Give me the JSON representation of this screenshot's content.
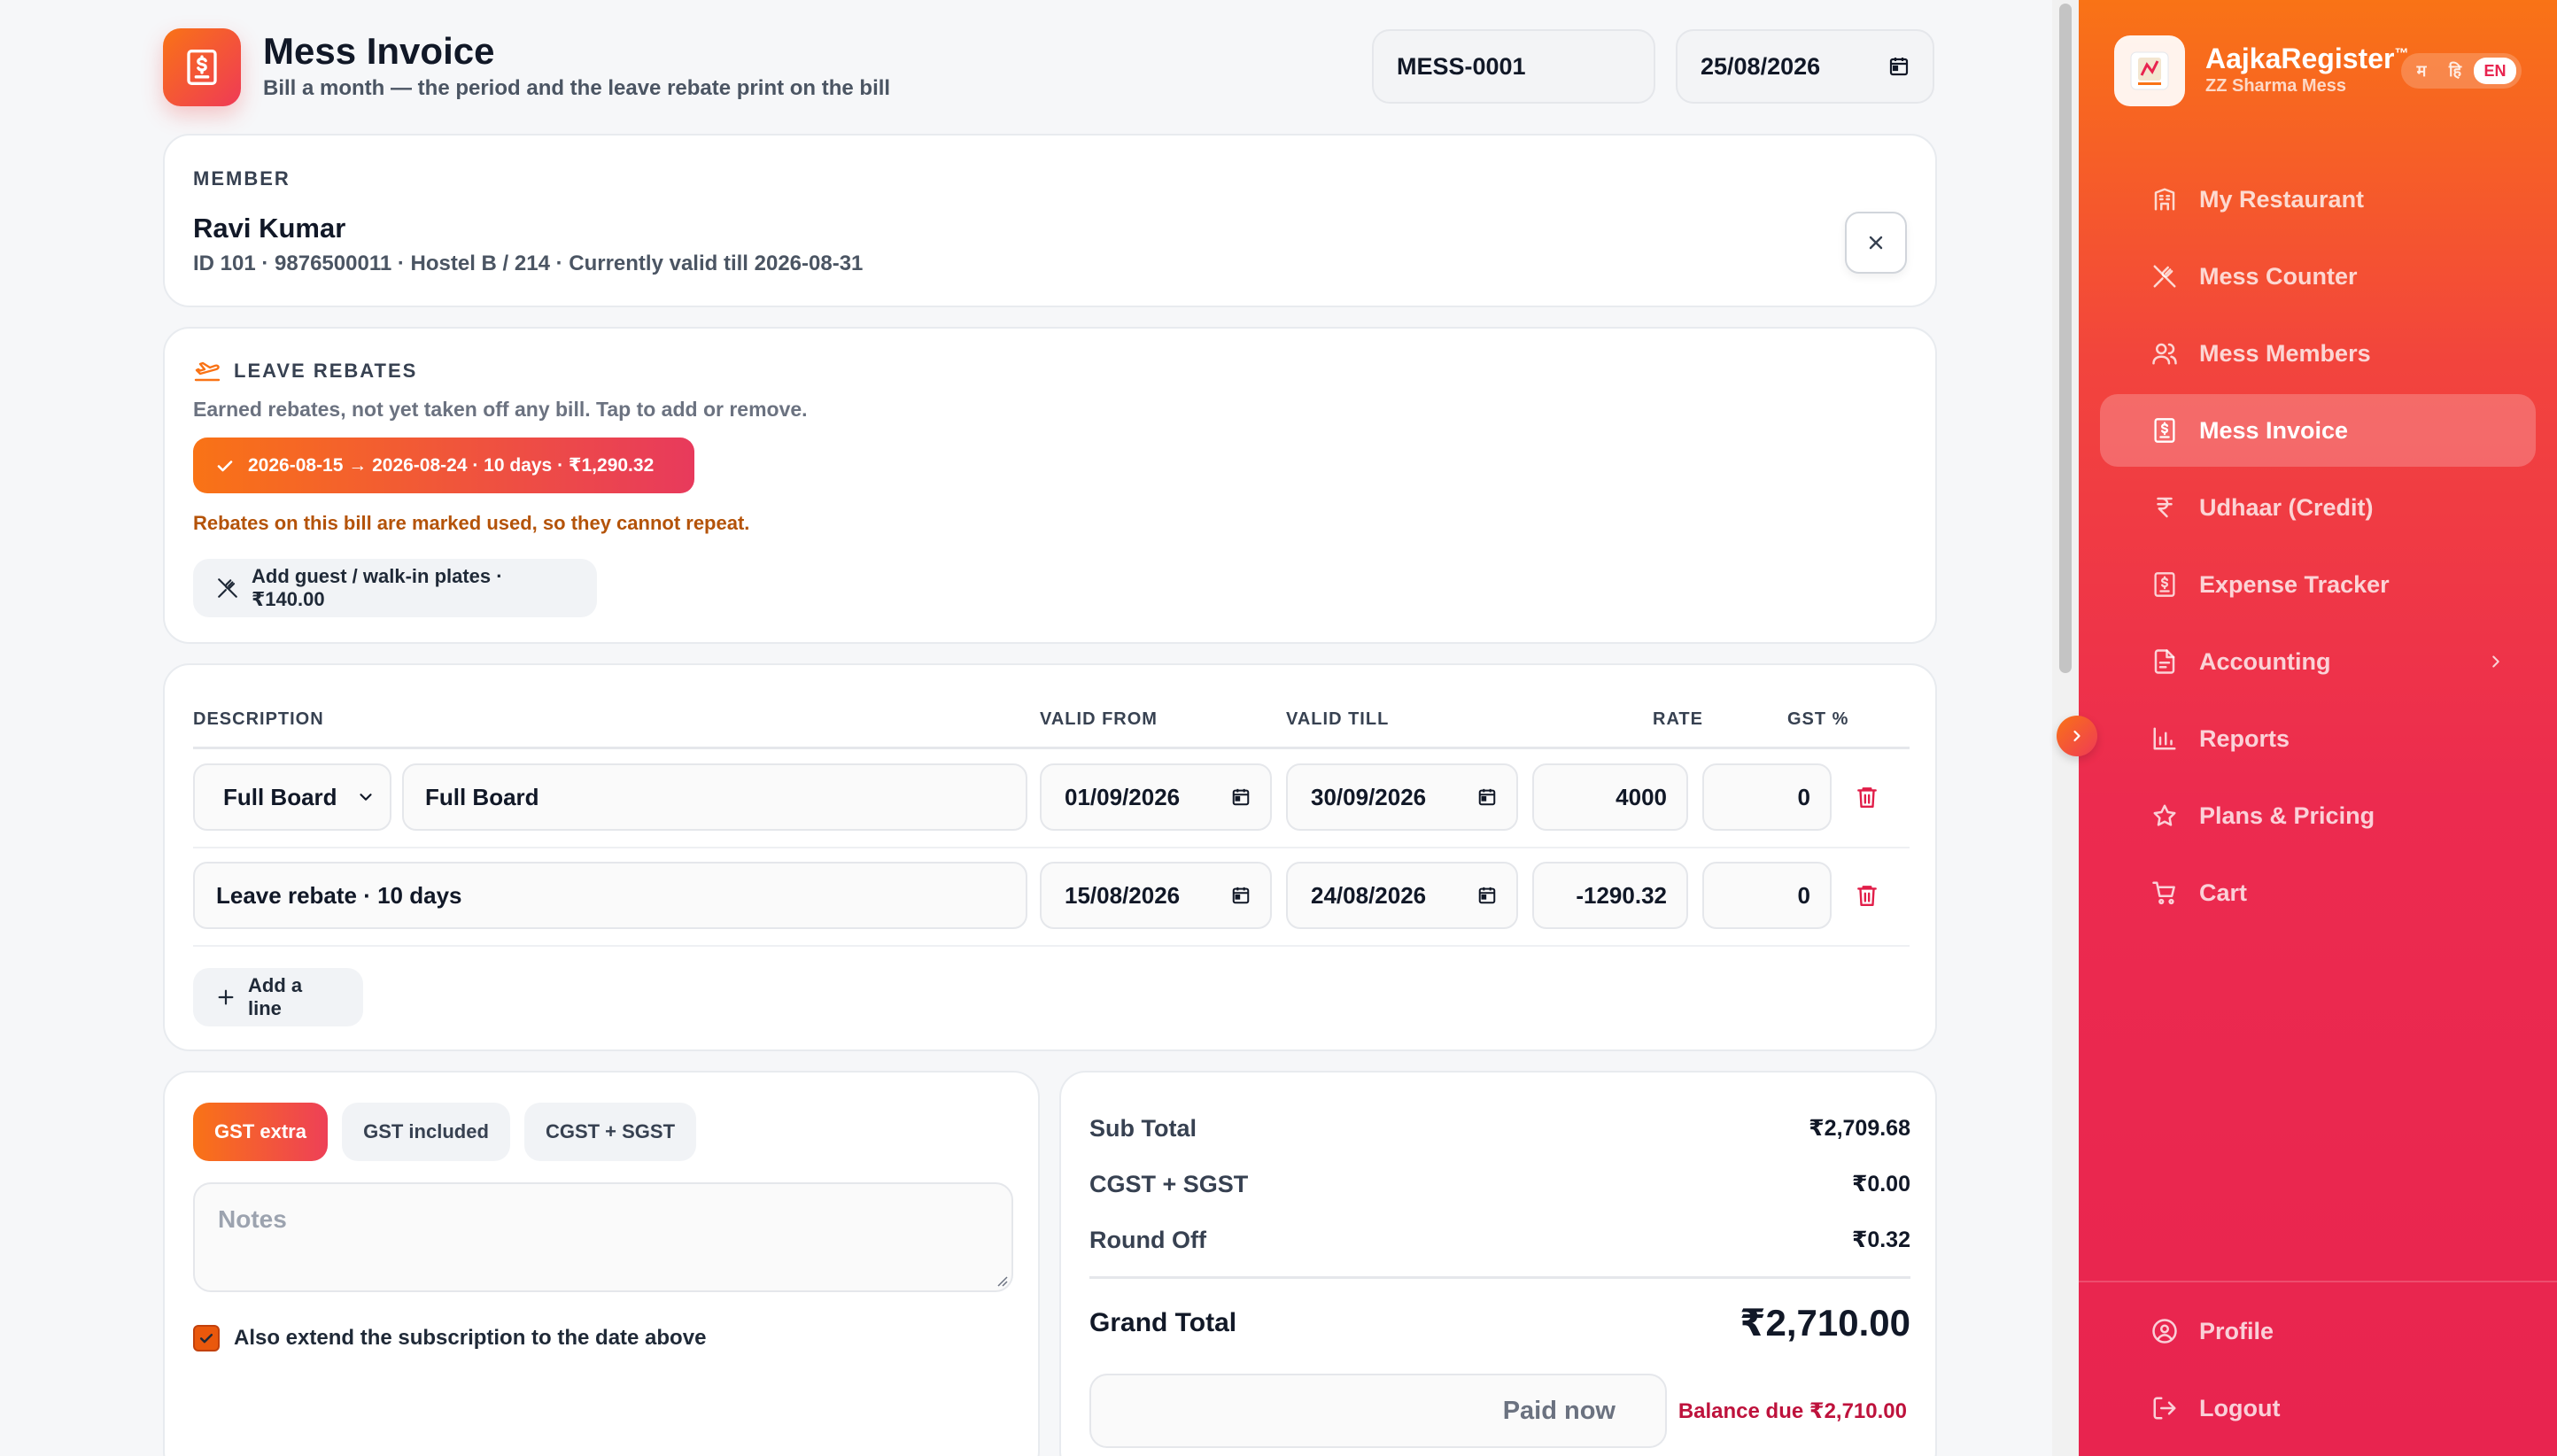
{
  "header": {
    "title": "Mess Invoice",
    "subtitle": "Bill a month — the period and the leave rebate print on the bill",
    "invoice_number": "MESS-0001",
    "invoice_date": "25/08/2026"
  },
  "member": {
    "section_label": "MEMBER",
    "name": "Ravi Kumar",
    "meta": "ID 101 · 9876500011 · Hostel B / 214 · Currently valid till 2026-08-31"
  },
  "rebates": {
    "section_label": "LEAVE REBATES",
    "description": "Earned rebates, not yet taken off any bill. Tap to add or remove.",
    "chip_label": "2026-08-15 → 2026-08-24 · 10 days · ₹1,290.32",
    "warning": "Rebates on this bill are marked used, so they cannot repeat.",
    "guest_label": "Add guest / walk-in plates · ₹140.00"
  },
  "lines": {
    "headers": {
      "description": "DESCRIPTION",
      "valid_from": "VALID FROM",
      "valid_till": "VALID TILL",
      "rate": "RATE",
      "gst": "GST %"
    },
    "rows": [
      {
        "plan": "Full Board",
        "description": "Full Board",
        "valid_from": "01/09/2026",
        "valid_till": "30/09/2026",
        "rate": "4000",
        "gst": "0"
      },
      {
        "description": "Leave rebate · 10 days",
        "valid_from": "15/08/2026",
        "valid_till": "24/08/2026",
        "rate": "-1290.32",
        "gst": "0"
      }
    ],
    "add_line_label": "Add a line"
  },
  "options": {
    "gst_tabs": [
      "GST extra",
      "GST included",
      "CGST + SGST"
    ],
    "notes_placeholder": "Notes",
    "extend_label": "Also extend the subscription to the date above",
    "extend_checked": true
  },
  "totals": {
    "sub_total_label": "Sub Total",
    "sub_total": "₹2,709.68",
    "gst_label": "CGST + SGST",
    "gst_value": "₹0.00",
    "round_off_label": "Round Off",
    "round_off": "₹0.32",
    "grand_total_label": "Grand Total",
    "grand_total": "₹2,710.00",
    "paid_placeholder": "Paid now",
    "balance_due": "Balance due ₹2,710.00"
  },
  "sidebar": {
    "brand_name": "AajkaRegister",
    "brand_tm": "™",
    "brand_sub": "ZZ Sharma Mess",
    "languages": [
      "म",
      "हि",
      "EN"
    ],
    "active_language": "EN",
    "items": [
      {
        "label": "My Restaurant",
        "icon": "building-icon"
      },
      {
        "label": "Mess Counter",
        "icon": "utensils-crossed-icon"
      },
      {
        "label": "Mess Members",
        "icon": "users-icon"
      },
      {
        "label": "Mess Invoice",
        "icon": "receipt-icon"
      },
      {
        "label": "Udhaar (Credit)",
        "icon": "rupee-icon"
      },
      {
        "label": "Expense Tracker",
        "icon": "receipt-icon"
      },
      {
        "label": "Accounting",
        "icon": "document-icon"
      },
      {
        "label": "Reports",
        "icon": "bar-chart-icon"
      },
      {
        "label": "Plans & Pricing",
        "icon": "star-icon"
      },
      {
        "label": "Cart",
        "icon": "cart-icon"
      }
    ],
    "active_item": "Mess Invoice",
    "footer_items": [
      {
        "label": "Profile",
        "icon": "user-circle-icon"
      },
      {
        "label": "Logout",
        "icon": "logout-icon"
      }
    ]
  },
  "colors": {
    "accent_orange": "#f97316",
    "accent_red": "#e8244f",
    "warning": "#b45309",
    "balance": "#be123c"
  }
}
